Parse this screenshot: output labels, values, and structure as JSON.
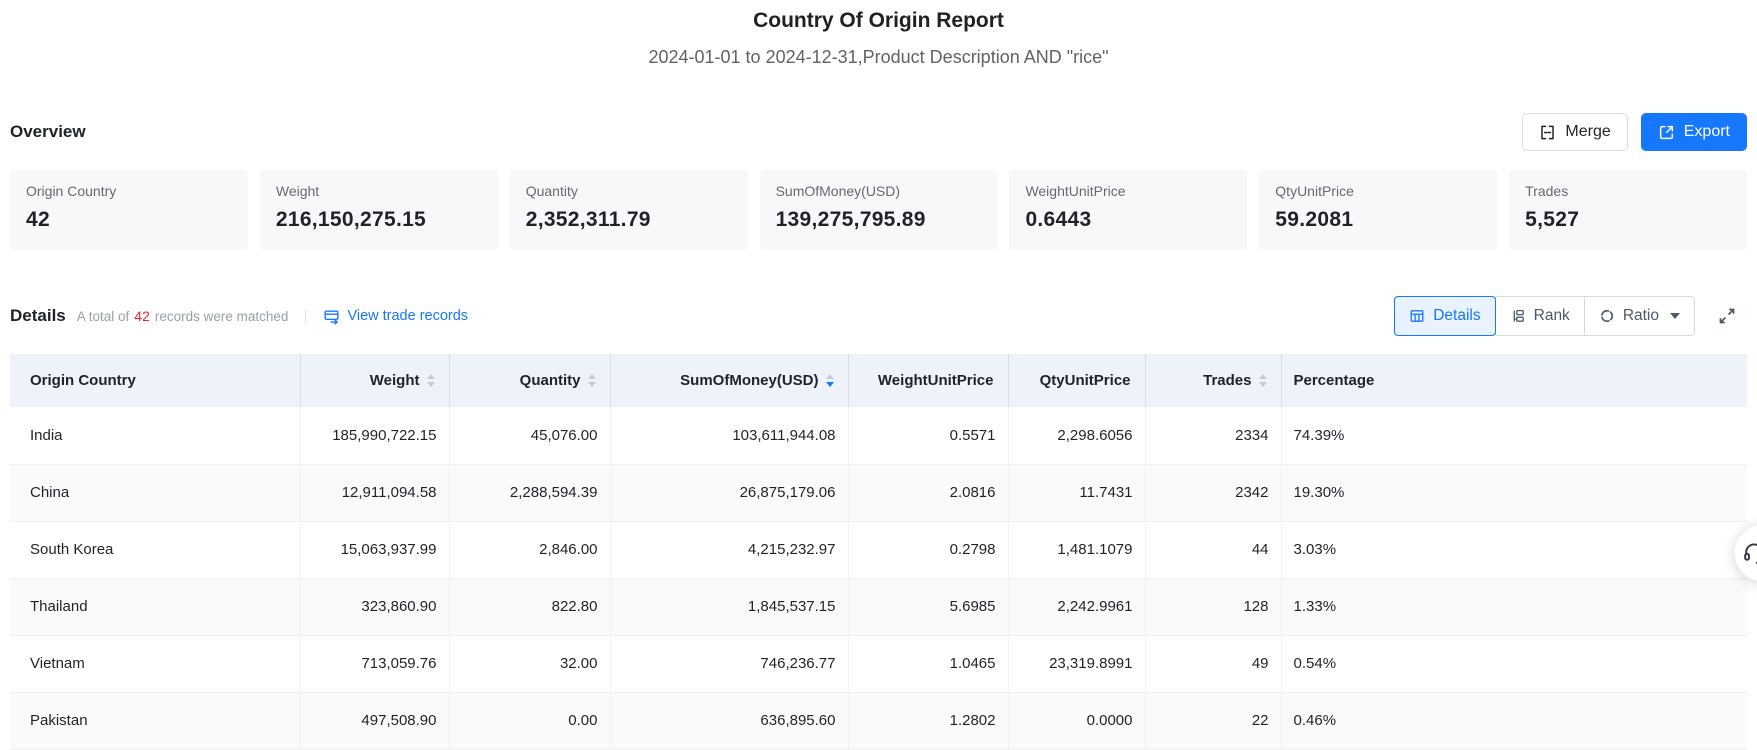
{
  "report": {
    "title": "Country Of Origin Report",
    "subtitle": "2024-01-01 to 2024-12-31,Product Description AND \"rice\""
  },
  "toolbar": {
    "merge_label": "Merge",
    "export_label": "Export"
  },
  "overview": {
    "heading": "Overview",
    "cards": [
      {
        "label": "Origin Country",
        "value": "42"
      },
      {
        "label": "Weight",
        "value": "216,150,275.15"
      },
      {
        "label": "Quantity",
        "value": "2,352,311.79"
      },
      {
        "label": "SumOfMoney(USD)",
        "value": "139,275,795.89"
      },
      {
        "label": "WeightUnitPrice",
        "value": "0.6443"
      },
      {
        "label": "QtyUnitPrice",
        "value": "59.2081"
      },
      {
        "label": "Trades",
        "value": "5,527"
      }
    ]
  },
  "details": {
    "heading": "Details",
    "total_prefix": "A total of",
    "total_count": "42",
    "total_suffix": "records were matched",
    "view_link": "View trade records",
    "tabs": [
      {
        "label": "Details",
        "active": true
      },
      {
        "label": "Rank",
        "active": false
      },
      {
        "label": "Ratio",
        "active": false,
        "has_dropdown": true
      }
    ]
  },
  "table": {
    "columns": [
      "Origin Country",
      "Weight",
      "Quantity",
      "SumOfMoney(USD)",
      "WeightUnitPrice",
      "QtyUnitPrice",
      "Trades",
      "Percentage"
    ],
    "sortable_columns": [
      "Weight",
      "Quantity",
      "SumOfMoney(USD)",
      "Trades"
    ],
    "sort": {
      "column": "SumOfMoney(USD)",
      "direction": "desc"
    },
    "rows": [
      [
        "India",
        "185,990,722.15",
        "45,076.00",
        "103,611,944.08",
        "0.5571",
        "2,298.6056",
        "2334",
        "74.39%"
      ],
      [
        "China",
        "12,911,094.58",
        "2,288,594.39",
        "26,875,179.06",
        "2.0816",
        "11.7431",
        "2342",
        "19.30%"
      ],
      [
        "South Korea",
        "15,063,937.99",
        "2,846.00",
        "4,215,232.97",
        "0.2798",
        "1,481.1079",
        "44",
        "3.03%"
      ],
      [
        "Thailand",
        "323,860.90",
        "822.80",
        "1,845,537.15",
        "5.6985",
        "2,242.9961",
        "128",
        "1.33%"
      ],
      [
        "Vietnam",
        "713,059.76",
        "32.00",
        "746,236.77",
        "1.0465",
        "23,319.8991",
        "49",
        "0.54%"
      ],
      [
        "Pakistan",
        "497,508.90",
        "0.00",
        "636,895.60",
        "1.2802",
        "0.0000",
        "22",
        "0.46%"
      ]
    ]
  },
  "icons": {
    "merge": "merge-cells",
    "export": "external-link",
    "view_trade": "card-arrow",
    "tab_details": "table-grid",
    "tab_rank": "rank-bracket",
    "tab_ratio": "donut-segments",
    "fullscreen": "expand-corners",
    "sort": "caret-up-down",
    "support": "headset"
  },
  "colors": {
    "accent": "#1677ff",
    "count_red": "#f5222d",
    "table_header_bg": "#edf2fb",
    "card_bg": "#f7f8fa",
    "tab_active_bg": "#e8f3ff",
    "muted_text": "#9aa0a6"
  }
}
